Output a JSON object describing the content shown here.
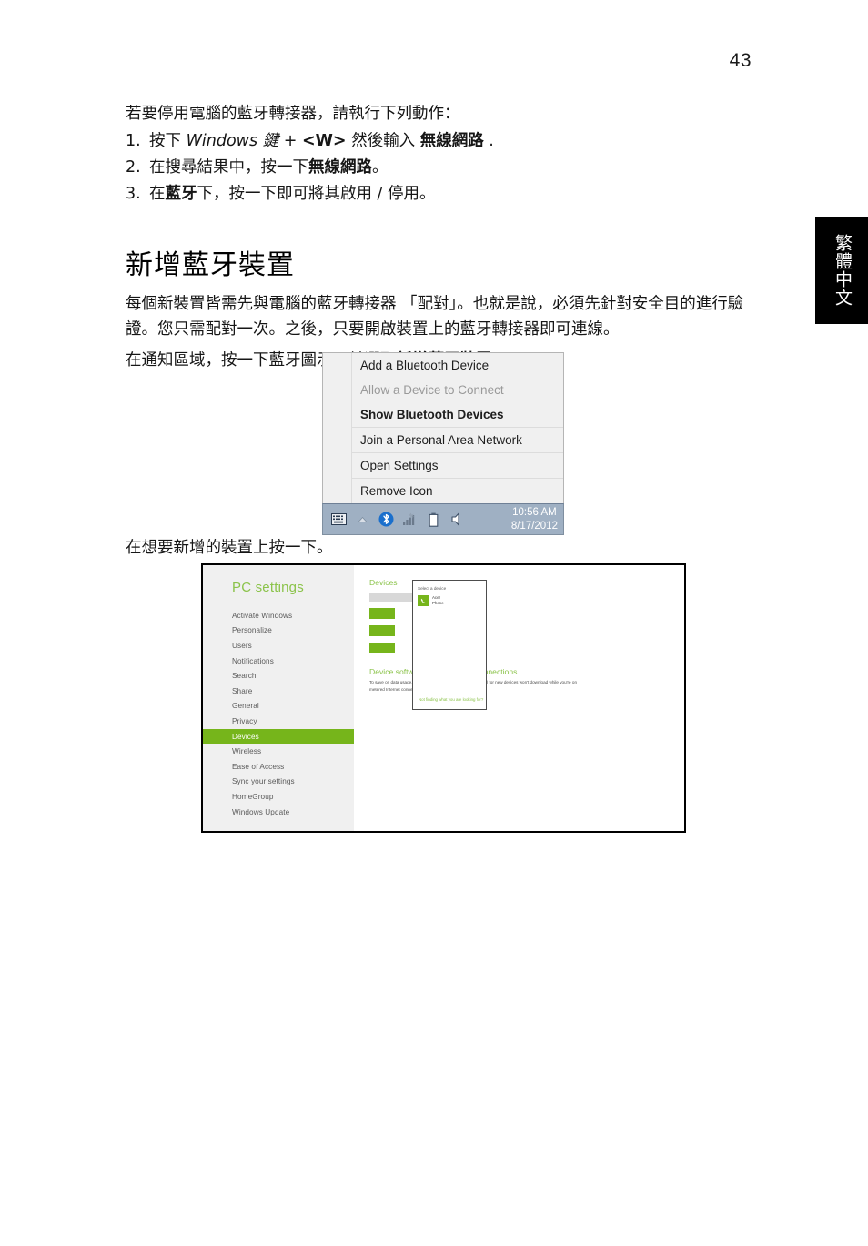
{
  "page": {
    "number": "43",
    "language_tab": "繁體中文"
  },
  "intro": {
    "line": "若要停用電腦的藍牙轉接器，請執行下列動作：",
    "steps": [
      {
        "num": "1.",
        "parts": [
          {
            "text": "按下 ",
            "style": "normal"
          },
          {
            "text": "Windows 鍵",
            "style": "italic"
          },
          {
            "text": " + ",
            "style": "normal"
          },
          {
            "text": "<W>",
            "style": "bold"
          },
          {
            "text": " 然後輸入 ",
            "style": "normal"
          },
          {
            "text": "無線網路",
            "style": "bold"
          },
          {
            "text": " .",
            "style": "normal"
          }
        ]
      },
      {
        "num": "2.",
        "parts": [
          {
            "text": "在搜尋結果中，按一下",
            "style": "normal"
          },
          {
            "text": "無線網路",
            "style": "bold"
          },
          {
            "text": "。",
            "style": "normal"
          }
        ]
      },
      {
        "num": "3.",
        "parts": [
          {
            "text": "在",
            "style": "normal"
          },
          {
            "text": "藍牙",
            "style": "bold"
          },
          {
            "text": "下，按一下即可將其啟用 / 停用。",
            "style": "normal"
          }
        ]
      }
    ]
  },
  "section": {
    "heading": "新增藍牙裝置",
    "paragraph_1": "每個新裝置皆需先與電腦的藍牙轉接器 「配對」。也就是說，必須先針對安全目的進行驗證。您只需配對一次。之後，只要開啟裝置上的藍牙轉接器即可連線。",
    "paragraph_2_parts": [
      {
        "text": "在通知區域，按一下藍牙圖示，並選取",
        "style": "normal"
      },
      {
        "text": "新增藍牙裝置",
        "style": "bold"
      },
      {
        "text": "。",
        "style": "normal"
      }
    ],
    "caption": "在想要新增的裝置上按一下。"
  },
  "tray_menu": {
    "items": [
      {
        "label": "Add a Bluetooth Device",
        "state": "normal",
        "separator": false
      },
      {
        "label": "Allow a Device to Connect",
        "state": "disabled",
        "separator": false
      },
      {
        "label": "Show Bluetooth Devices",
        "state": "bold",
        "separator": false
      },
      {
        "label": "Join a Personal Area Network",
        "state": "normal",
        "separator": true
      },
      {
        "label": "Open Settings",
        "state": "normal",
        "separator": true
      },
      {
        "label": "Remove Icon",
        "state": "normal",
        "separator": true
      }
    ],
    "taskbar": {
      "icons": [
        "keyboard-icon",
        "show-hidden-icons-chevron",
        "bluetooth-icon",
        "network-signal-icon",
        "battery-icon",
        "volume-icon"
      ],
      "time": "10:56 AM",
      "date": "8/17/2012",
      "bluetooth_color": "#1a6fcc",
      "background_color": "#9fb0c3"
    }
  },
  "pc_settings": {
    "title": "PC settings",
    "accent_color": "#76b51b",
    "nav_items": [
      {
        "label": "Activate Windows",
        "active": false
      },
      {
        "label": "Personalize",
        "active": false
      },
      {
        "label": "Users",
        "active": false
      },
      {
        "label": "Notifications",
        "active": false
      },
      {
        "label": "Search",
        "active": false
      },
      {
        "label": "Share",
        "active": false
      },
      {
        "label": "General",
        "active": false
      },
      {
        "label": "Privacy",
        "active": false
      },
      {
        "label": "Devices",
        "active": true
      },
      {
        "label": "Wireless",
        "active": false
      },
      {
        "label": "Ease of Access",
        "active": false
      },
      {
        "label": "Sync your settings",
        "active": false
      },
      {
        "label": "HomeGroup",
        "active": false
      },
      {
        "label": "Windows Update",
        "active": false
      }
    ],
    "main": {
      "heading": "Devices",
      "sub_heading": "Device software over metered connections",
      "body_text": "To save on data usage, device software (drivers, info, and apps) for new devices won't download while you're on metered Internet connections.",
      "toggle_state": "Off"
    },
    "device_flyout": {
      "label": "Select a device",
      "device_name": "Acer",
      "device_type": "Phone",
      "footer_link": "Not finding what you are looking for?"
    }
  }
}
